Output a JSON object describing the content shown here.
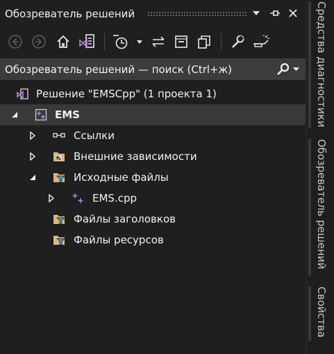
{
  "window": {
    "title": "Обозреватель решений",
    "menu_icon": "dropdown-triangle-icon",
    "pin_icon": "pin-icon",
    "close_icon": "close-icon"
  },
  "toolbar": {
    "items": [
      "back-icon",
      "forward-icon",
      "home-icon",
      "switch-views-icon",
      "pending-changes-filter-icon",
      "sync-active-document-icon",
      "collapse-all-icon",
      "show-all-files-icon",
      "properties-icon",
      "preview-icon"
    ]
  },
  "search": {
    "placeholder": "Обозреватель решений — поиск (Ctrl+ж)",
    "icon": "search-icon"
  },
  "tree": {
    "solution": "Решение \"EMSCpp\"  (1 проекта 1)",
    "project": "EMS",
    "items": [
      {
        "label": "Ссылки",
        "icon": "references-icon"
      },
      {
        "label": "Внешние зависимости",
        "icon": "external-dependencies-icon"
      },
      {
        "label": "Исходные файлы",
        "icon": "filter-folder-icon"
      },
      {
        "label": "EMS.cpp",
        "icon": "cpp-file-icon"
      },
      {
        "label": "Файлы заголовков",
        "icon": "filter-folder-icon"
      },
      {
        "label": "Файлы ресурсов",
        "icon": "filter-folder-icon"
      }
    ]
  },
  "side_tabs": {
    "diagnostics": "Средства диагностики",
    "solution_explorer": "Обозреватель решений",
    "properties": "Свойства"
  },
  "colors": {
    "background": "#1f1f1f",
    "selection": "#393939",
    "search_bg": "#3c3c3c",
    "vs_purple": "#b180d7",
    "folder_yellow": "#dcb67a",
    "filter_blue": "#3c9bd6"
  }
}
